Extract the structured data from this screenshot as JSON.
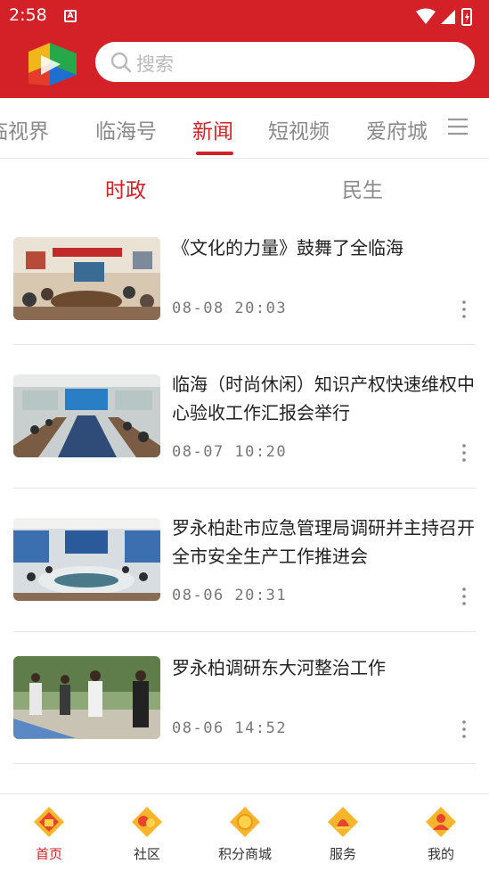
{
  "status_bar": {
    "time": "2:58",
    "notification_badge": "A",
    "icons": [
      "wifi-icon",
      "signal-icon",
      "battery-icon"
    ]
  },
  "header": {
    "brand_color": "#d42128",
    "search_placeholder": "搜索"
  },
  "channel_tabs": [
    {
      "label": "临视界",
      "active": false
    },
    {
      "label": "临海号",
      "active": false
    },
    {
      "label": "新闻",
      "active": true
    },
    {
      "label": "短视频",
      "active": false
    },
    {
      "label": "爱府城",
      "active": false
    }
  ],
  "sub_tabs": [
    {
      "label": "时政",
      "active": true
    },
    {
      "label": "民生",
      "active": false
    }
  ],
  "news": [
    {
      "title": "《文化的力量》鼓舞了全临海",
      "time": "08-08  20:03"
    },
    {
      "title": "临海（时尚休闲）知识产权快速维权中心验收工作汇报会举行",
      "time": "08-07  10:20"
    },
    {
      "title": "罗永柏赴市应急管理局调研并主持召开全市安全生产工作推进会",
      "time": "08-06  20:31"
    },
    {
      "title": "罗永柏调研东大河整治工作",
      "time": "08-06  14:52"
    }
  ],
  "bottom_nav": [
    {
      "label": "首页",
      "icon": "home-icon",
      "active": true
    },
    {
      "label": "社区",
      "icon": "community-icon",
      "active": false
    },
    {
      "label": "积分商城",
      "icon": "points-mall-icon",
      "active": false
    },
    {
      "label": "服务",
      "icon": "service-icon",
      "active": false
    },
    {
      "label": "我的",
      "icon": "profile-icon",
      "active": false
    }
  ]
}
